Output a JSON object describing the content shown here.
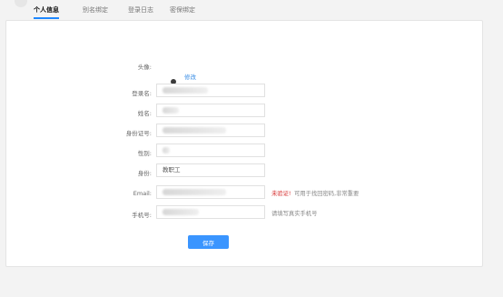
{
  "tabs": [
    {
      "label": "个人信息"
    },
    {
      "label": "别名绑定"
    },
    {
      "label": "登录日志"
    },
    {
      "label": "密保绑定"
    }
  ],
  "form": {
    "avatar_label": "头像:",
    "avatar_change_label": "修改",
    "username_label": "登录名:",
    "name_label": "姓名:",
    "idcard_label": "身份证号:",
    "gender_label": "性别:",
    "identity_label": "身份:",
    "identity_value": "教职工",
    "email_label": "Email:",
    "email_warning": "未验证!",
    "email_note": "可用于找回密码,非常重要",
    "phone_label": "手机号:",
    "phone_note": "请填写真实手机号",
    "save_label": "保存"
  },
  "colors": {
    "accent": "#3a95ff",
    "link": "#3a8ee6",
    "warning": "#d52b2b"
  }
}
